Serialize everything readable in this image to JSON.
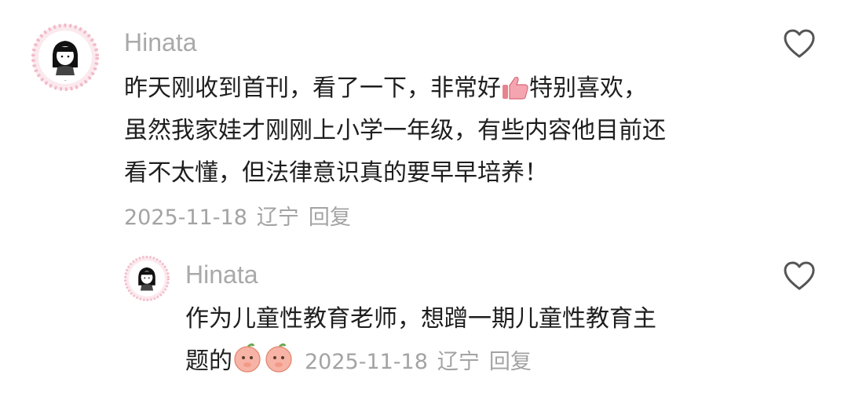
{
  "comments": [
    {
      "username": "Hinata",
      "avatar_icon": "avatar-girl-floral-frame",
      "lines": [
        "昨天刚收到首刊，看了一下，非常好",
        "特别喜欢，",
        "虽然我家娃才刚刚上小学一年级，有些内容他目前还",
        "看不太懂，但法律意识真的要早早培养！"
      ],
      "inline_emoji": "thumbs-up-emoji",
      "date": "2025-11-18",
      "location": "辽宁",
      "reply_label": "回复",
      "like_icon": "heart-outline-icon"
    },
    {
      "username": "Hinata",
      "avatar_icon": "avatar-girl-floral-frame",
      "lines": [
        "作为儿童性教育老师，想蹭一期儿童性教育主",
        "题的"
      ],
      "inline_emoji": "peach-thinking-emoji",
      "date": "2025-11-18",
      "location": "辽宁",
      "reply_label": "回复",
      "like_icon": "heart-outline-icon"
    }
  ],
  "colors": {
    "username": "#a9a9a9",
    "text": "#1e1e1e",
    "meta": "#a3a3a3",
    "icon": "#555555"
  }
}
